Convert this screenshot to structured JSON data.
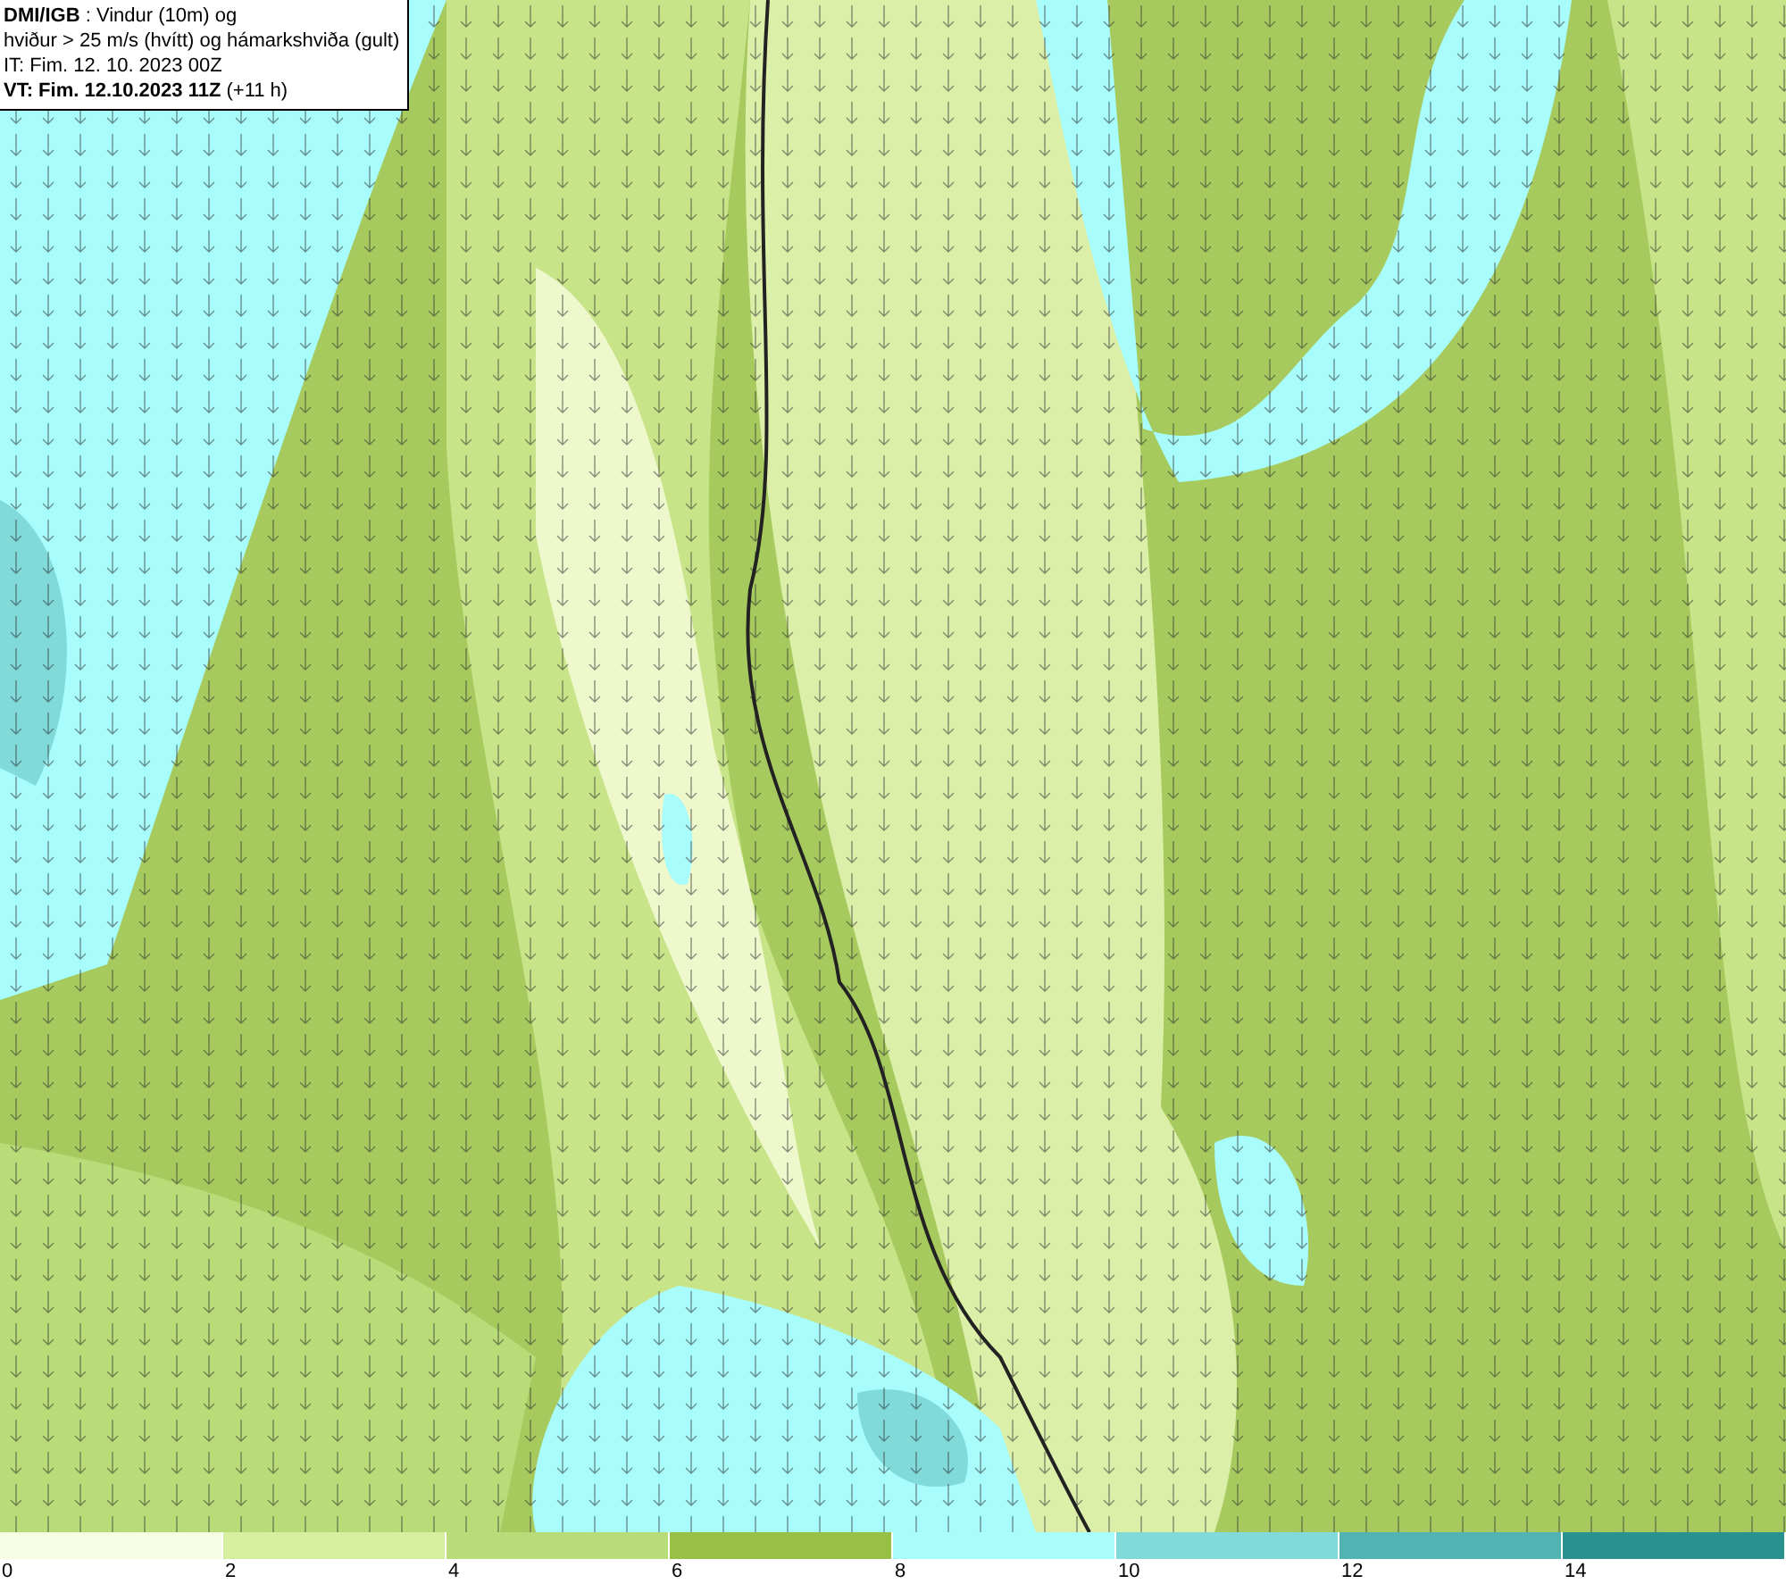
{
  "header": {
    "lines": [
      "**DMI/IGB** : Vindur (10m) og",
      "hviður > 25 m/s (hvítt) og hámarkshviða (gult)",
      "IT: Fim. 12. 10. 2023 00Z",
      "**VT: Fim. 12.10.2023 11Z** (+11 h)"
    ]
  },
  "legend": {
    "bins": [
      {
        "color": "#f6fde2",
        "label": "0"
      },
      {
        "color": "#d6eea0",
        "label": "2"
      },
      {
        "color": "#b8dc78",
        "label": "4"
      },
      {
        "color": "#98bf46",
        "label": "6"
      },
      {
        "color": "#a8fcfc",
        "label": "8"
      },
      {
        "color": "#80dada",
        "label": "10"
      },
      {
        "color": "#52b3b3",
        "label": "12"
      },
      {
        "color": "#2a928e",
        "label": "14"
      }
    ]
  }
}
